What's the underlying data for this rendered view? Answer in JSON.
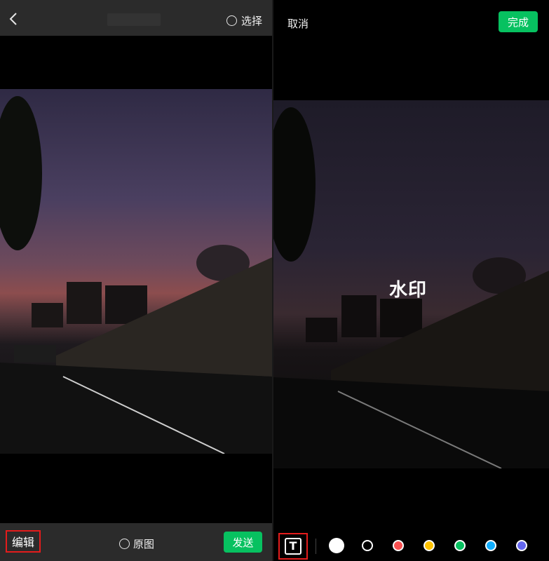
{
  "left": {
    "topbar": {
      "select_label": "选择"
    },
    "bottombar": {
      "edit_label": "编辑",
      "original_label": "原图",
      "send_label": "发送"
    }
  },
  "right": {
    "topbar": {
      "cancel_label": "取消",
      "done_label": "完成"
    },
    "watermark_text": "水印",
    "toolbar": {
      "text_tool_glyph": "T",
      "colors": [
        {
          "name": "white",
          "hex": "#ffffff",
          "selected": true
        },
        {
          "name": "black",
          "hex": "#000000"
        },
        {
          "name": "red",
          "hex": "#fa5151"
        },
        {
          "name": "yellow",
          "hex": "#ffc300"
        },
        {
          "name": "green",
          "hex": "#07c160"
        },
        {
          "name": "blue",
          "hex": "#10aeff"
        },
        {
          "name": "purple",
          "hex": "#6467f0"
        }
      ]
    }
  },
  "accent": "#07c160",
  "highlight": "#e41c1c"
}
